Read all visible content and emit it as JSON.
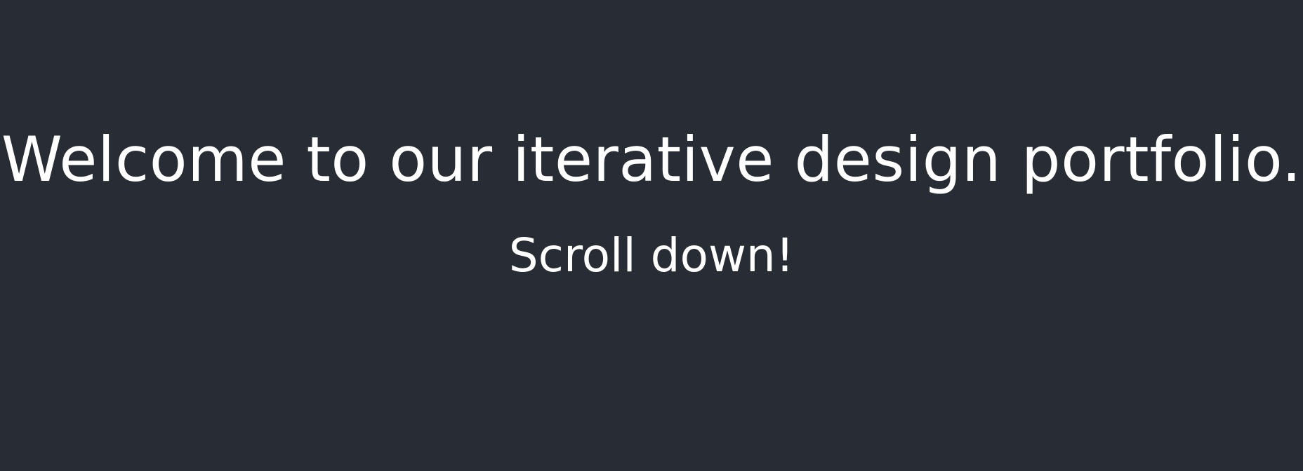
{
  "hero": {
    "headline": "Welcome to our iterative design portfolio.",
    "subline": "Scroll down!"
  },
  "colors": {
    "background": "#282c34",
    "text": "#ffffff"
  }
}
